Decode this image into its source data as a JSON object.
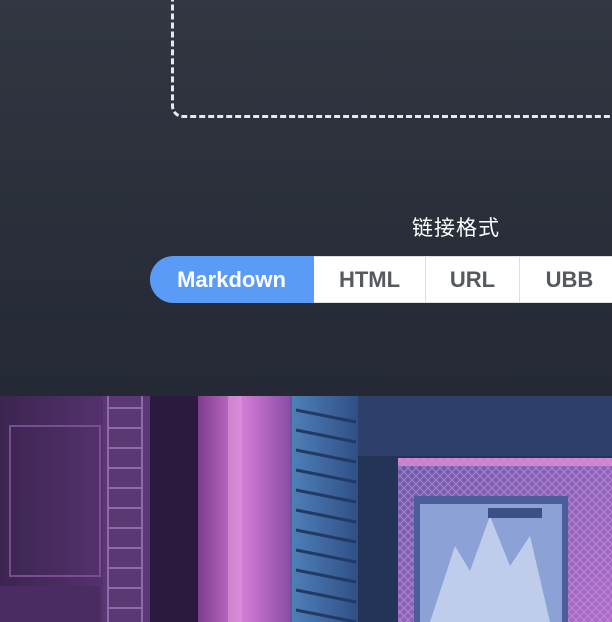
{
  "link_format": {
    "label": "链接格式",
    "options": [
      "Markdown",
      "HTML",
      "URL",
      "UBB"
    ],
    "selected": "Markdown"
  },
  "colors": {
    "accent": "#5b9bf8",
    "panel_bg": "#2b303b",
    "dashed_border": "#e6e8ec"
  }
}
